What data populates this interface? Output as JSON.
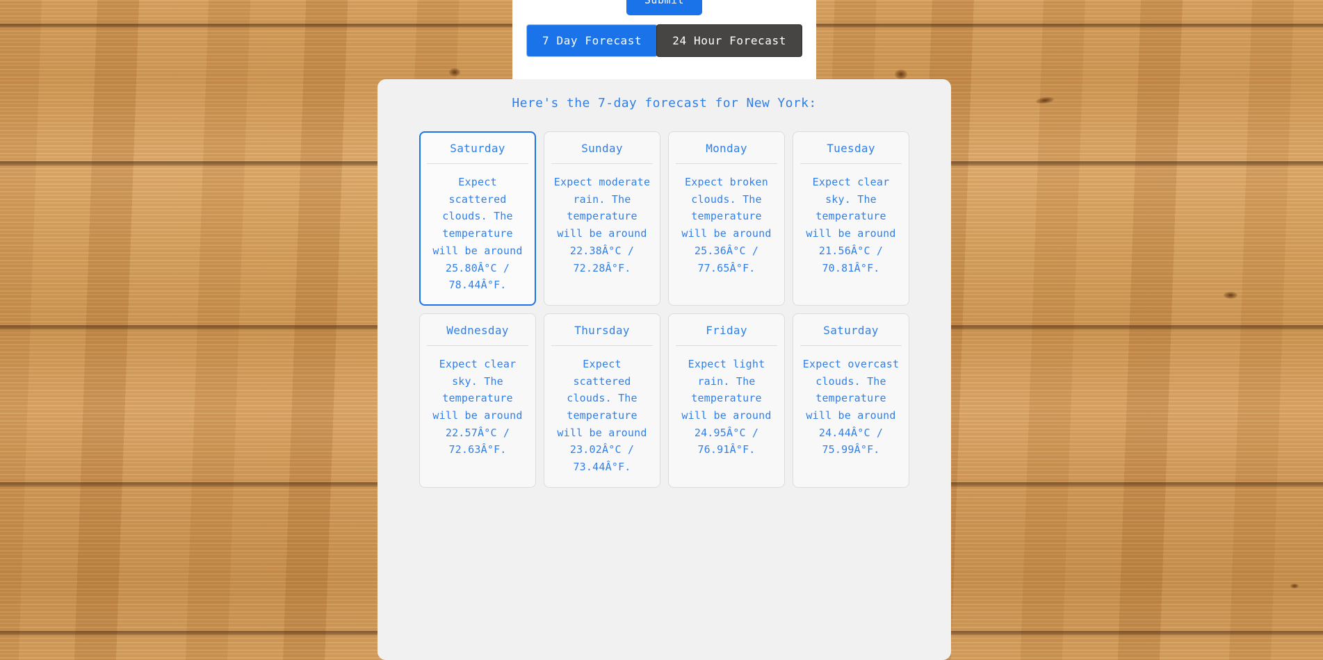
{
  "form": {
    "submit_label": "Submit",
    "tabs": [
      {
        "label": "7 Day Forecast",
        "state": "active"
      },
      {
        "label": "24 Hour Forecast",
        "state": "inactive"
      }
    ]
  },
  "forecast": {
    "heading": "Here's the 7-day forecast for New York:",
    "location": "New York",
    "days": [
      {
        "day": "Saturday",
        "description": "Expect scattered clouds. The temperature will be around 25.80Â°C / 78.44Â°F.",
        "condition": "scattered clouds",
        "temp_c": "25.80",
        "temp_f": "78.44",
        "selected": true
      },
      {
        "day": "Sunday",
        "description": "Expect moderate rain. The temperature will be around 22.38Â°C / 72.28Â°F.",
        "condition": "moderate rain",
        "temp_c": "22.38",
        "temp_f": "72.28",
        "selected": false
      },
      {
        "day": "Monday",
        "description": "Expect broken clouds. The temperature will be around 25.36Â°C / 77.65Â°F.",
        "condition": "broken clouds",
        "temp_c": "25.36",
        "temp_f": "77.65",
        "selected": false
      },
      {
        "day": "Tuesday",
        "description": "Expect clear sky. The temperature will be around 21.56Â°C / 70.81Â°F.",
        "condition": "clear sky",
        "temp_c": "21.56",
        "temp_f": "70.81",
        "selected": false
      },
      {
        "day": "Wednesday",
        "description": "Expect clear sky. The temperature will be around 22.57Â°C / 72.63Â°F.",
        "condition": "clear sky",
        "temp_c": "22.57",
        "temp_f": "72.63",
        "selected": false
      },
      {
        "day": "Thursday",
        "description": "Expect scattered clouds. The temperature will be around 23.02Â°C / 73.44Â°F.",
        "condition": "scattered clouds",
        "temp_c": "23.02",
        "temp_f": "73.44",
        "selected": false
      },
      {
        "day": "Friday",
        "description": "Expect light rain. The temperature will be around 24.95Â°C / 76.91Â°F.",
        "condition": "light rain",
        "temp_c": "24.95",
        "temp_f": "76.91",
        "selected": false
      },
      {
        "day": "Saturday",
        "description": "Expect overcast clouds. The temperature will be around 24.44Â°C / 75.99Â°F.",
        "condition": "overcast clouds",
        "temp_c": "24.44",
        "temp_f": "75.99",
        "selected": false
      }
    ]
  },
  "colors": {
    "accent_blue": "#1a73e8",
    "text_blue": "#2f7fe8",
    "tab_inactive": "#474543",
    "panel_bg": "#f1f1f1",
    "card_bg": "#f8f8f8",
    "card_border": "#dcdcdc"
  }
}
